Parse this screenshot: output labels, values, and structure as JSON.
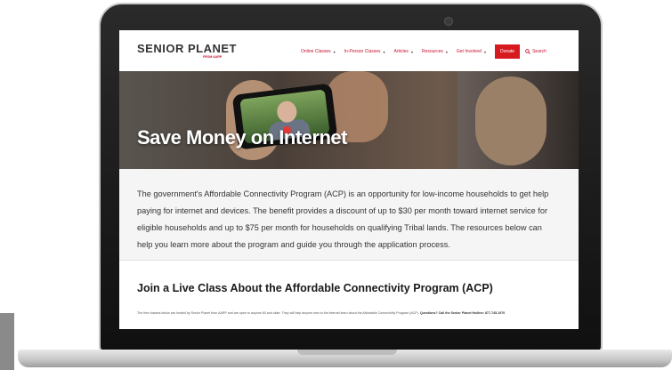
{
  "brand": {
    "name": "SENIOR PLANET",
    "sub": "FROM AARP"
  },
  "nav": {
    "items": [
      {
        "label": "Online Classes"
      },
      {
        "label": "In-Person Classes"
      },
      {
        "label": "Articles"
      },
      {
        "label": "Resources"
      },
      {
        "label": "Get Involved"
      }
    ],
    "donate": "Donate",
    "search": "Search"
  },
  "hero": {
    "title": "Save Money on Internet"
  },
  "intro": {
    "text": "The government's Affordable Connectivity Program (ACP) is an opportunity for low-income households to get help paying for internet and devices. The benefit provides a discount of up to $30 per month toward internet service for eligible households and up to $75 per month for households on qualifying Tribal lands. The resources below can help you learn more about the program and guide you through the application process."
  },
  "section": {
    "title": "Join a Live Class About the Affordable Connectivity Program (ACP)",
    "text": "The free classes below are hosted by Senior Planet from AARP and are open to anyone 60 and older. They will help anyone new to the internet learn about the Affordable Connectivity Program (ACP).",
    "strong": "Questions? Call the Senior Planet Hotline: 877-745-1970"
  },
  "colors": {
    "accent": "#c8102e",
    "donate": "#d71920"
  }
}
